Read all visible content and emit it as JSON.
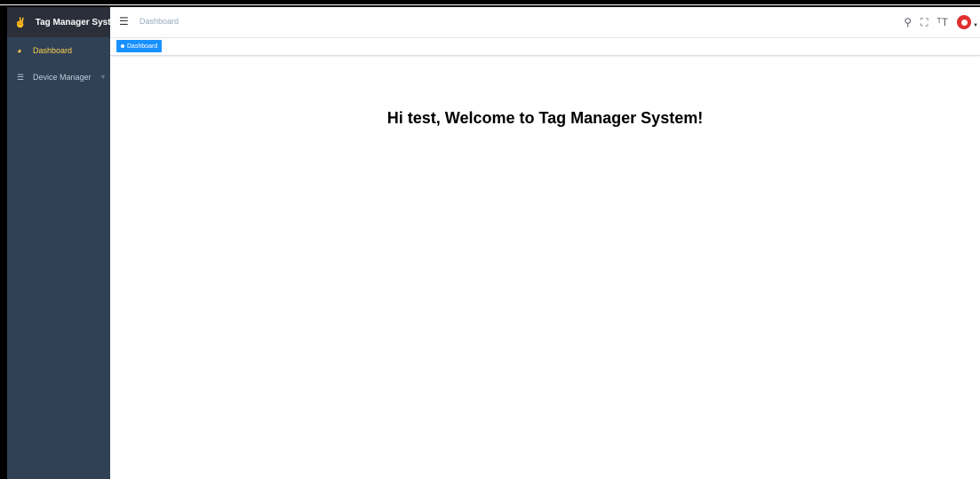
{
  "sidebar": {
    "logo_title": "Tag Manager System",
    "logo_icon": "hand-logo-icon",
    "items": [
      {
        "label": "Dashboard",
        "icon": "dashboard-icon",
        "active": true
      },
      {
        "label": "Device Manager",
        "icon": "list-icon",
        "active": false
      }
    ]
  },
  "navbar": {
    "breadcrumb": "Dashboard",
    "icons": [
      "search-icon",
      "fullscreen-icon",
      "font-size-icon"
    ]
  },
  "tags_view": {
    "tags": [
      {
        "label": "Dashboard",
        "active": true
      }
    ]
  },
  "main": {
    "welcome": "Hi test, Welcome to Tag Manager System!"
  },
  "colors": {
    "sidebar_bg": "#304156",
    "active_menu": "#ffd04b",
    "tag_active": "#1890ff",
    "avatar": "#e02f2f"
  }
}
